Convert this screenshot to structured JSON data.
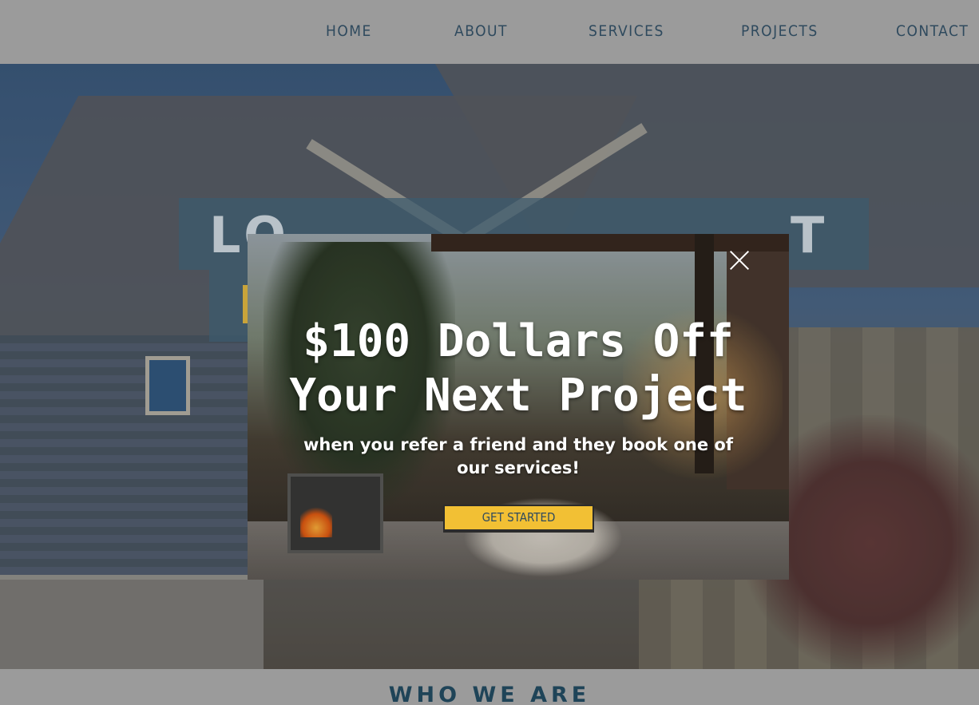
{
  "nav": {
    "items": [
      {
        "label": "HOME"
      },
      {
        "label": "ABOUT"
      },
      {
        "label": "SERVICES"
      },
      {
        "label": "PROJECTS"
      },
      {
        "label": "CONTACT"
      }
    ]
  },
  "hero": {
    "headline_start": "LO",
    "headline_end": "T"
  },
  "popup": {
    "title": "$100 Dollars Off Your Next Project",
    "subtitle": "when you refer a friend and they book one of our services!",
    "cta_label": "GET STARTED",
    "close_icon": "close-icon"
  },
  "about": {
    "heading": "WHO WE ARE"
  },
  "colors": {
    "nav_text": "#2f4a5e",
    "cta_bg": "#f2c034",
    "heading": "#1f4458"
  }
}
